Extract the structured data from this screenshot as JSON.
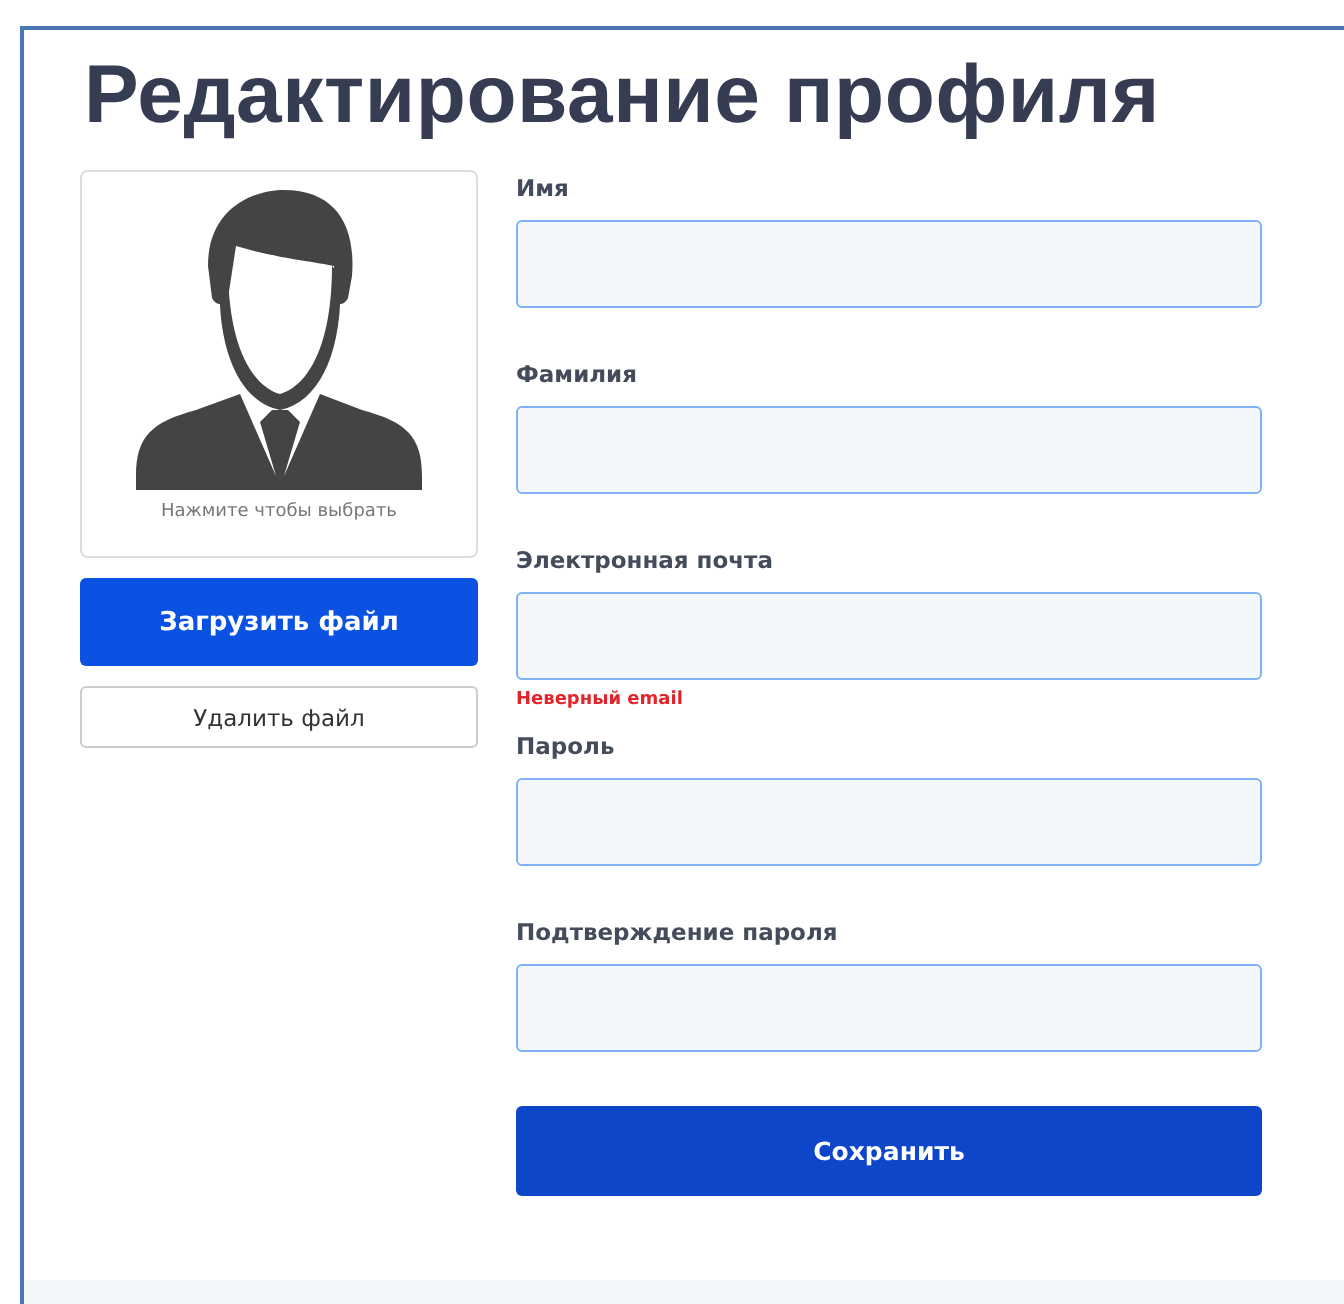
{
  "title": "Редактирование профиля",
  "avatar": {
    "hint": "Нажмите чтобы выбрать"
  },
  "upload_button": "Загрузить файл",
  "delete_button": "Удалить файл",
  "fields": [
    {
      "label": "Имя"
    },
    {
      "label": "Фамилия"
    },
    {
      "label": "Электронная почта",
      "error": "Неверный email"
    },
    {
      "label": "Пароль"
    },
    {
      "label": "Подтверждение пароля"
    }
  ],
  "save_button": "Сохранить"
}
